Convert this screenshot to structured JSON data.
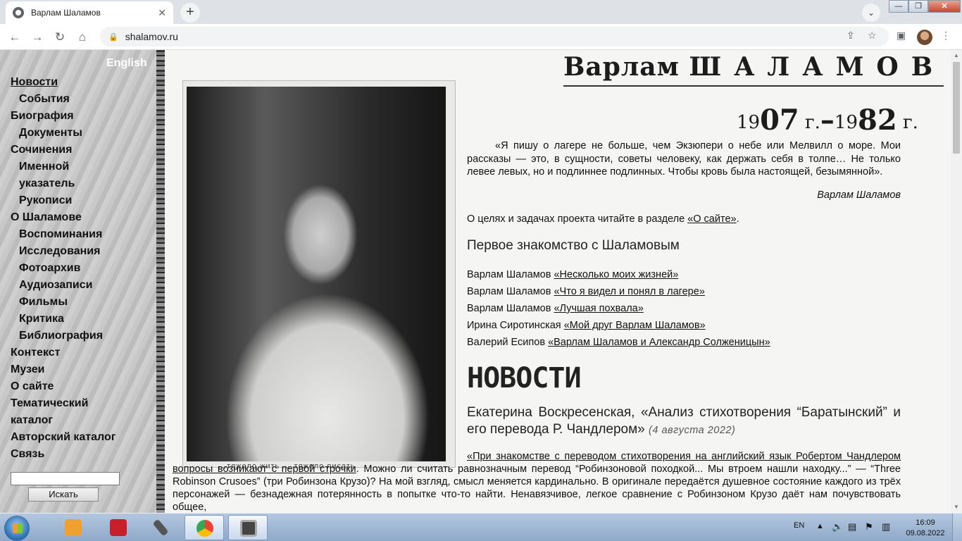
{
  "browser": {
    "tab_title": "Варлам Шаламов",
    "tab_close": "✕",
    "new_tab": "+",
    "tab_menu": "⌄",
    "url": "shalamov.ru",
    "window_controls": {
      "minimize": "—",
      "maximize": "❐",
      "close": "✕"
    },
    "nav": {
      "back": "←",
      "forward": "→",
      "reload": "↻",
      "home": "⌂"
    }
  },
  "site": {
    "language_link": "English",
    "title_first": "Варлам",
    "title_last": "ШАЛАМОВ",
    "years": {
      "born_prefix": "19",
      "born_suffix": "07",
      "born_unit": "г.",
      "dash": "–",
      "died_prefix": "19",
      "died_suffix": "82",
      "died_unit": "г."
    },
    "photo_caption": "...тяжело жить ... тяжело писать"
  },
  "menu": [
    {
      "label": "Новости",
      "sub": false,
      "active": true
    },
    {
      "label": "События",
      "sub": true
    },
    {
      "label": "Биография",
      "sub": false
    },
    {
      "label": "Документы",
      "sub": true
    },
    {
      "label": "Сочинения",
      "sub": false
    },
    {
      "label": "Именной",
      "sub": true
    },
    {
      "label": "указатель",
      "sub": true
    },
    {
      "label": "Рукописи",
      "sub": true
    },
    {
      "label": "О Шаламове",
      "sub": false
    },
    {
      "label": "Воспоминания",
      "sub": true
    },
    {
      "label": "Исследования",
      "sub": true
    },
    {
      "label": "Фотоархив",
      "sub": true
    },
    {
      "label": "Аудиозаписи",
      "sub": true
    },
    {
      "label": "Фильмы",
      "sub": true
    },
    {
      "label": "Критика",
      "sub": true
    },
    {
      "label": "Библиография",
      "sub": true
    },
    {
      "label": "Контекст",
      "sub": false
    },
    {
      "label": "Музеи",
      "sub": false
    },
    {
      "label": "О сайте",
      "sub": false
    },
    {
      "label": "Тематический",
      "sub": false
    },
    {
      "label": "каталог",
      "sub": false
    },
    {
      "label": "Авторский каталог",
      "sub": false
    },
    {
      "label": "Связь",
      "sub": false
    }
  ],
  "search": {
    "value": "",
    "button": "Искать"
  },
  "quote": {
    "text": "«Я пишу о лагере не больше, чем Экзюпери о небе или Мелвилл о море. Мои рассказы — это, в сущности, советы человеку, как держать себя в толпе… Не только левее левых, но и подлиннее подлинных. Чтобы кровь была настоящей, безымянной».",
    "author": "Варлам Шаламов"
  },
  "about": {
    "text": "О целях и задачах проекта читайте в разделе ",
    "link": "«О сайте»",
    "end": "."
  },
  "first_acquaintance": {
    "heading": "Первое знакомство с Шаламовым",
    "items": [
      {
        "author": "Варлам Шаламов ",
        "link": "«Несколько моих жизней»"
      },
      {
        "author": "Варлам Шаламов ",
        "link": "«Что я видел и понял в лагере»"
      },
      {
        "author": "Варлам Шаламов ",
        "link": "«Лучшая похвала»"
      },
      {
        "author": "Ирина Сиротинская ",
        "link": "«Мой друг Варлам Шаламов»"
      },
      {
        "author": "Валерий Есипов ",
        "link": "«Варлам Шаламов и Александр Солженицын»"
      }
    ]
  },
  "news": {
    "heading": "НОВОСТИ",
    "title": "Екатерина Воскресенская, «Анализ стихотворения “Баратынский” и его перевода Р. Чандлером»",
    "date": "(4 августа 2022)",
    "body_link": "«При знакомстве с переводом стихотворения на английский язык Робертом Чандлером вопросы возникают с первой строчки",
    "body_text": ". Можно ли считать равнозначным перевод “Робинзоновой походкой... Мы втроем нашли находку...” — “Three Robinson Crusoes” (три Робинзона Крузо)? На мой взгляд, смысл меняется кардинально. В оригинале передаётся душевное состояние каждого из трёх персонажей — безнадежная потерянность в попытке что-то найти. Ненавязчивое, легкое сравнение с Робинзоном Крузо даёт нам почувствовать общее,"
  },
  "taskbar": {
    "language": "EN",
    "time": "16:09",
    "date": "09.08.2022"
  }
}
